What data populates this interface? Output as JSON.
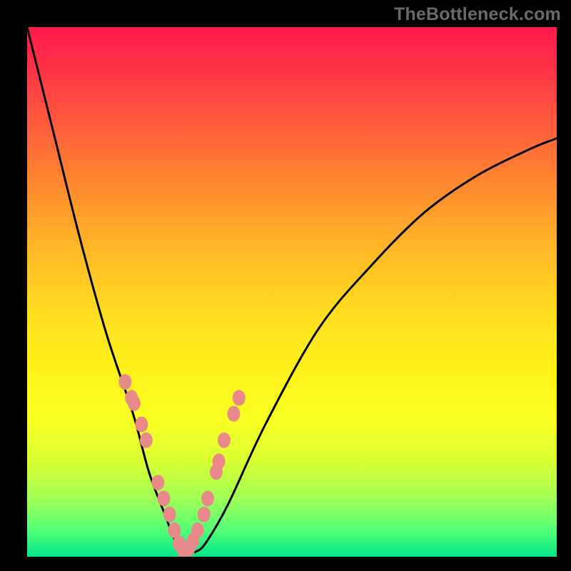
{
  "watermark": {
    "text": "TheBottleneck.com"
  },
  "chart_data": {
    "type": "line",
    "title": "",
    "xlabel": "",
    "ylabel": "",
    "xlim": [
      0,
      100
    ],
    "ylim": [
      0,
      100
    ],
    "series": [
      {
        "name": "bottleneck-curve",
        "x": [
          0,
          5,
          10,
          15,
          20,
          23,
          26,
          28,
          30,
          32,
          34,
          38,
          45,
          55,
          65,
          75,
          85,
          95,
          100
        ],
        "y": [
          100,
          80,
          60,
          42,
          27,
          16,
          8,
          3,
          1,
          1,
          3,
          10,
          25,
          43,
          55,
          65,
          72,
          77,
          79
        ]
      }
    ],
    "markers": {
      "name": "highlight-points",
      "color": "#e88a8a",
      "x": [
        18.5,
        19.7,
        20.2,
        21.6,
        22.5,
        24.7,
        25.8,
        26.9,
        27.8,
        28.7,
        29.5,
        30.5,
        31.3,
        32.2,
        33.4,
        34.1,
        35.7,
        36.2,
        37.2,
        39.0,
        40.0
      ],
      "y": [
        33,
        30,
        29,
        25,
        22,
        14,
        11,
        8,
        5,
        2.5,
        1.2,
        1.5,
        3,
        5,
        8,
        11,
        16,
        18,
        22,
        27,
        30
      ]
    },
    "gradient_bands": [
      {
        "color": "#ff1a4d",
        "stop": 0
      },
      {
        "color": "#ffb827",
        "stop": 50
      },
      {
        "color": "#fff21a",
        "stop": 70
      },
      {
        "color": "#00e58a",
        "stop": 100
      }
    ]
  }
}
